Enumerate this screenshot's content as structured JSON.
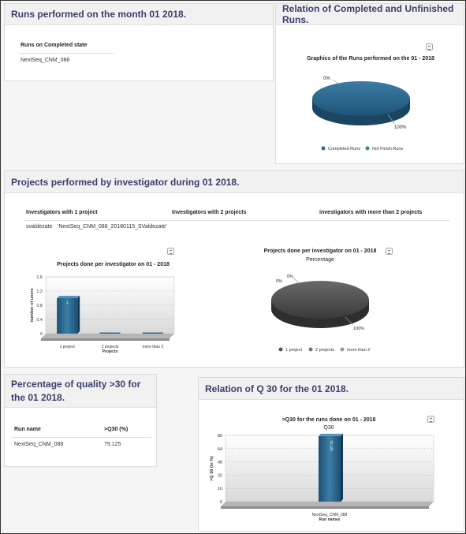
{
  "runs_panel": {
    "title": "Runs performed on the month 01 2018.",
    "table_header": "Runs on Completed state",
    "rows": [
      "NextSeq_CNM_088"
    ]
  },
  "relation_panel": {
    "title": "Relation of Completed and Unfinished Runs.",
    "chart_title": "Graphics of the Runs performed on the 01 - 2018",
    "slice_labels": [
      "0%",
      "100%"
    ],
    "legend": [
      "Completed Runs",
      "Not Finish Runs"
    ]
  },
  "projects_panel": {
    "title": "Projects performed by investigator during 01 2018.",
    "columns": [
      "Investigators with 1 project",
      "Investigators with 2 projects",
      "investigators with more than 2 projects"
    ],
    "row": [
      "svaldezate",
      "'NextSeq_CNM_088_20180115_SValdezate'"
    ],
    "bar_chart_title": "Projects done per investigator on 01 - 2018",
    "bar_value_label": "1",
    "pie_chart_title": "Projects done per investigator on 01 - 2018",
    "pie_subtitle": "Percentage",
    "pie_labels": [
      "0%",
      "0%",
      "100%"
    ]
  },
  "quality_panel": {
    "title": "Percentage of quality >30 for the 01 2018.",
    "headers": [
      "Run name",
      ">Q30 (%)"
    ],
    "rows": [
      [
        "NextSeq_CNM_088",
        "79.125"
      ]
    ]
  },
  "q30_panel": {
    "title": "Relation of Q 30 for the 01 2018.",
    "chart_title": ">Q30 for the runs done on 01 - 2018",
    "chart_subtitle": "Q30",
    "bar_value_label": "79.125"
  },
  "chart_data": [
    {
      "type": "pie",
      "title": "Graphics of the Runs performed on the 01 - 2018",
      "categories": [
        "Completed Runs",
        "Not Finish Runs"
      ],
      "values": [
        100,
        0
      ],
      "colors": [
        "#2e6a90",
        "#2f8f7a"
      ]
    },
    {
      "type": "bar",
      "title": "Projects done per investigator on 01 - 2018",
      "categories": [
        "1 project",
        "2 projects",
        "more than 2"
      ],
      "values": [
        1,
        0,
        0
      ],
      "xlabel": "Projects",
      "ylabel": "number of users",
      "ylim": [
        0,
        1.6
      ],
      "yticks": [
        0,
        0.4,
        0.8,
        1.2,
        1.6
      ],
      "ytick_labels": [
        "0",
        "0.4",
        "0.8",
        "1.2",
        "1.6"
      ]
    },
    {
      "type": "pie",
      "title": "Projects done per investigator on 01 - 2018",
      "subtitle": "Percentage",
      "categories": [
        "1 project",
        "2 projects",
        "more than 2"
      ],
      "values": [
        100,
        0,
        0
      ],
      "colors": [
        "#555555",
        "#777777",
        "#999999"
      ]
    },
    {
      "type": "bar",
      "title": ">Q30 for the runs done on 01 - 2018",
      "subtitle": "Q30",
      "categories": [
        "NextSeq_CNM_088"
      ],
      "values": [
        79.125
      ],
      "xlabel": "Run names",
      "ylabel": ">Q 30 (in %)",
      "ylim": [
        0,
        80
      ],
      "yticks": [
        0,
        16,
        32,
        48,
        64,
        80
      ],
      "ytick_labels": [
        "0",
        "16",
        "32",
        "48",
        "64",
        "80"
      ]
    }
  ]
}
